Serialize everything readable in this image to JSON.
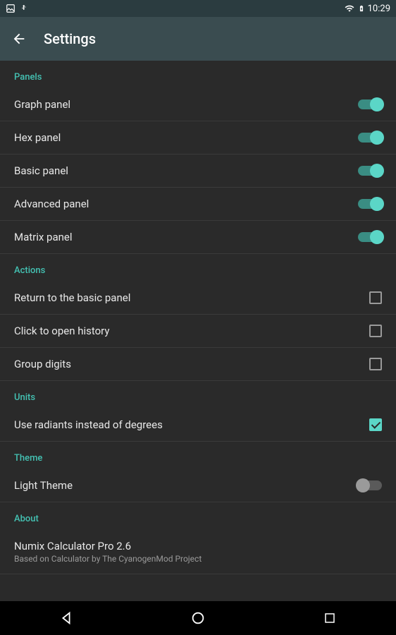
{
  "status": {
    "time": "10:29"
  },
  "appbar": {
    "title": "Settings"
  },
  "sections": {
    "panels": {
      "header": "Panels",
      "items": [
        {
          "label": "Graph panel",
          "on": true
        },
        {
          "label": "Hex panel",
          "on": true
        },
        {
          "label": "Basic panel",
          "on": true
        },
        {
          "label": "Advanced panel",
          "on": true
        },
        {
          "label": "Matrix panel",
          "on": true
        }
      ]
    },
    "actions": {
      "header": "Actions",
      "items": [
        {
          "label": "Return to the basic panel",
          "checked": false
        },
        {
          "label": "Click to open history",
          "checked": false
        },
        {
          "label": "Group digits",
          "checked": false
        }
      ]
    },
    "units": {
      "header": "Units",
      "item": {
        "label": "Use radiants instead of degrees",
        "checked": true
      }
    },
    "theme": {
      "header": "Theme",
      "item": {
        "label": "Light Theme",
        "on": false
      }
    },
    "about": {
      "header": "About",
      "title": "Numix Calculator Pro 2.6",
      "sub": "Based on Calculator by The CyanogenMod Project"
    }
  }
}
